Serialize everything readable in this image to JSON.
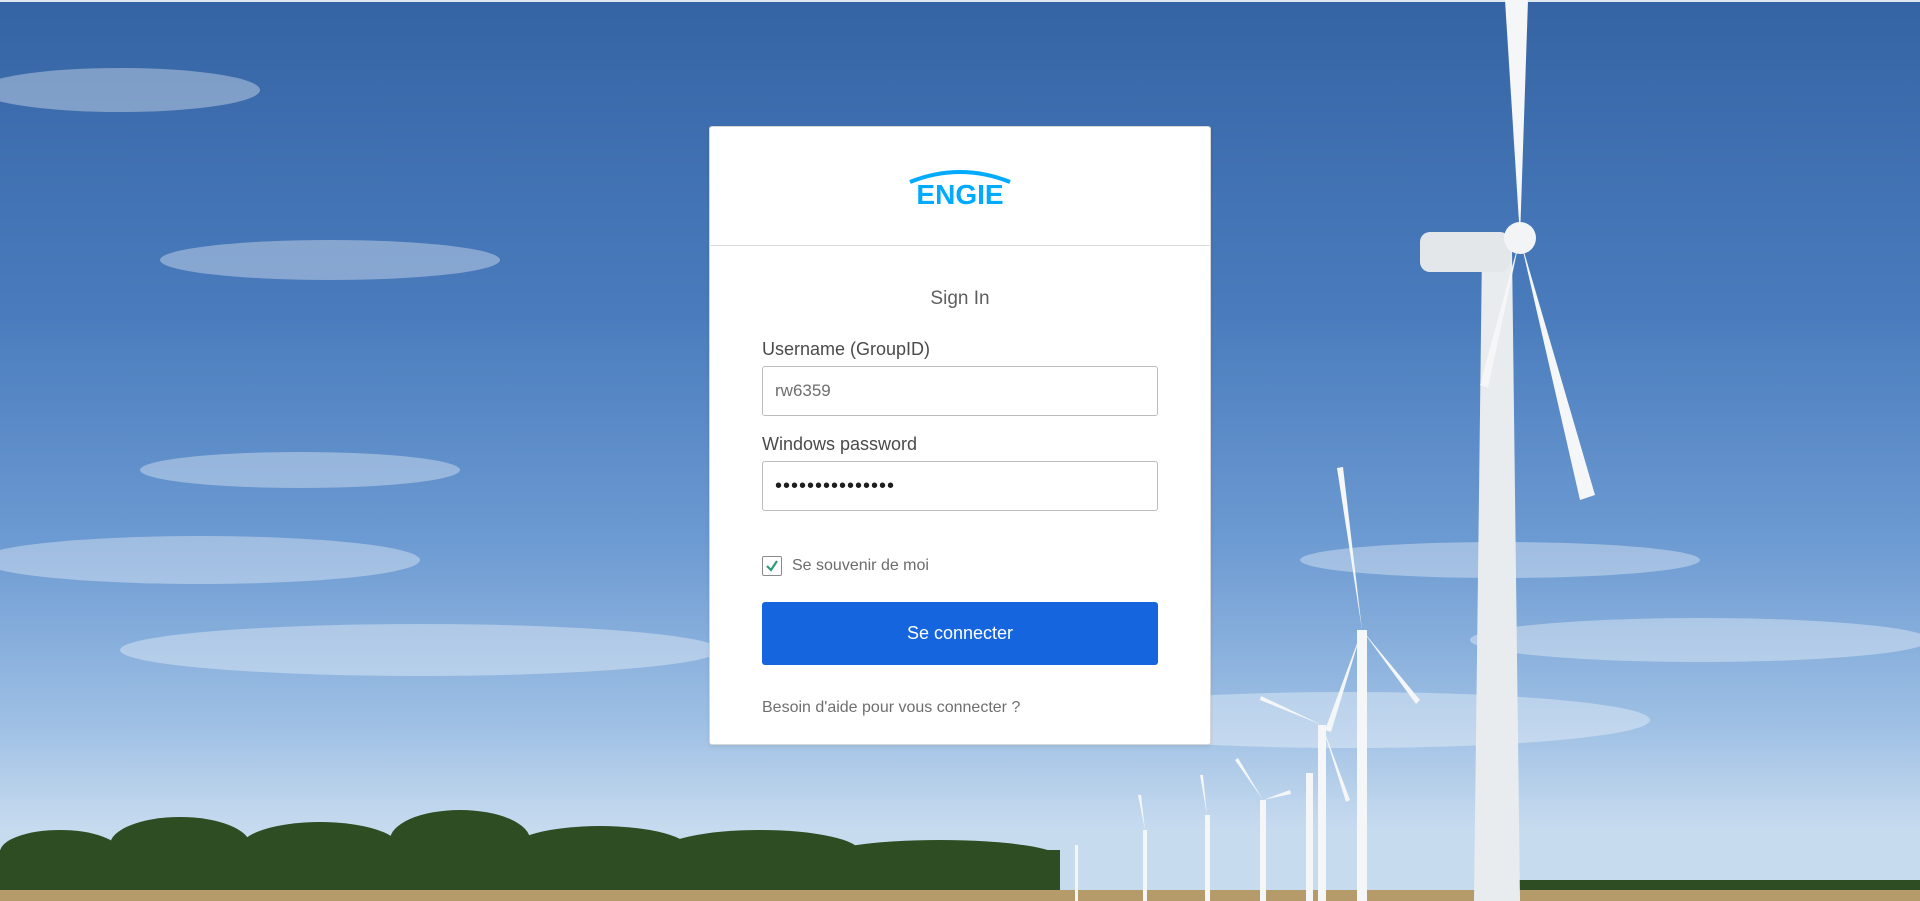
{
  "brand": {
    "logo_text": "ENGIE",
    "accent_color": "#00aaff"
  },
  "form": {
    "title": "Sign In",
    "username_label": "Username (GroupID)",
    "username_value": "rw6359",
    "password_label": "Windows password",
    "password_value": "•••••••••••••••",
    "remember_label": "Se souvenir de moi",
    "remember_checked": true,
    "submit_label": "Se connecter",
    "help_link": "Besoin d'aide pour vous connecter ?"
  },
  "colors": {
    "primary_button": "#1565df",
    "check_color": "#2f9c73"
  },
  "background": {
    "scene_icon": "wind-turbines-icon"
  }
}
